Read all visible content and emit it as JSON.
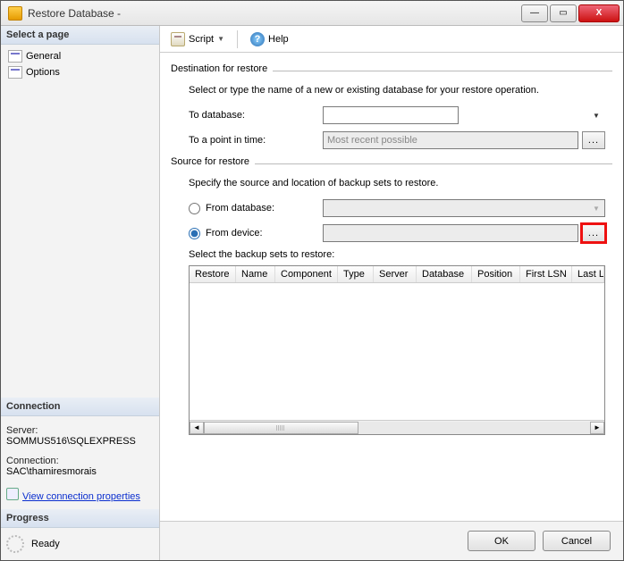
{
  "window": {
    "title": "Restore Database -"
  },
  "winButtons": {
    "close": "X"
  },
  "sidebar": {
    "select_page_header": "Select a page",
    "items": [
      {
        "label": "General"
      },
      {
        "label": "Options"
      }
    ],
    "connection_header": "Connection",
    "server_label": "Server:",
    "server_value": "SOMMUS516\\SQLEXPRESS",
    "connection_label": "Connection:",
    "connection_value": "SAC\\thamiresmorais",
    "view_props_link": "View connection properties",
    "progress_header": "Progress",
    "progress_status": "Ready"
  },
  "toolbar": {
    "script_label": "Script",
    "help_label": "Help"
  },
  "destination": {
    "legend": "Destination for restore",
    "description": "Select or type the name of a new or existing database for your restore operation.",
    "to_database_label": "To database:",
    "to_database_value": "",
    "point_in_time_label": "To a point in time:",
    "point_in_time_value": "Most recent possible"
  },
  "source": {
    "legend": "Source for restore",
    "description": "Specify the source and location of backup sets to restore.",
    "from_database_label": "From database:",
    "from_database_value": "",
    "from_device_label": "From device:",
    "from_device_value": "",
    "selected_option": "device",
    "backup_sets_label": "Select the backup sets to restore:",
    "grid_headers": [
      "Restore",
      "Name",
      "Component",
      "Type",
      "Server",
      "Database",
      "Position",
      "First LSN",
      "Last LSN"
    ]
  },
  "footer": {
    "ok_label": "OK",
    "cancel_label": "Cancel"
  },
  "ellipsis": "..."
}
